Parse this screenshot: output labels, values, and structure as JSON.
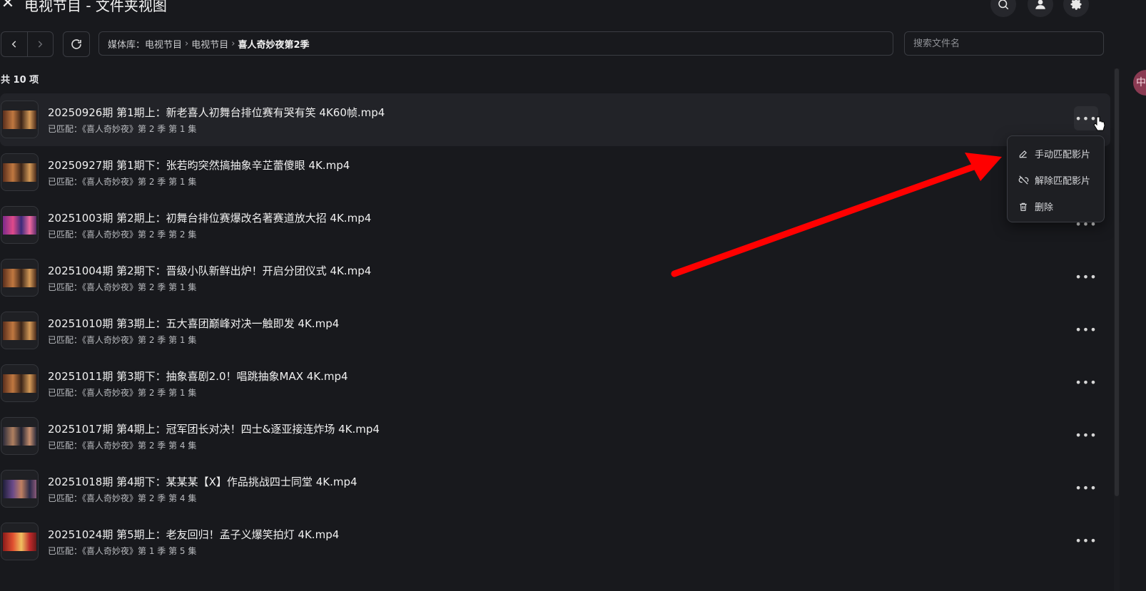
{
  "header": {
    "title": "电视节目 - 文件夹视图"
  },
  "toolbar": {
    "breadcrumb": [
      "媒体库：电视节目",
      "电视节目",
      "喜人奇妙夜第2季"
    ],
    "search_placeholder": "搜索文件名"
  },
  "count_label": "共 10 项",
  "files": [
    {
      "name": "20250926期 第1期上：新老喜人初舞台排位赛有哭有笑 4K60帧.mp4",
      "match": "已匹配：《喜人奇妙夜》第 2 季 第 1 集"
    },
    {
      "name": "20250927期 第1期下：张若昀突然搞抽象辛芷蕾傻眼 4K.mp4",
      "match": "已匹配：《喜人奇妙夜》第 2 季 第 1 集"
    },
    {
      "name": "20251003期 第2期上：初舞台排位赛爆改名著赛道放大招 4K.mp4",
      "match": "已匹配：《喜人奇妙夜》第 2 季 第 2 集"
    },
    {
      "name": "20251004期 第2期下：晋级小队新鲜出炉！开启分团仪式 4K.mp4",
      "match": "已匹配：《喜人奇妙夜》第 2 季 第 1 集"
    },
    {
      "name": "20251010期 第3期上：五大喜团巅峰对决一触即发 4K.mp4",
      "match": "已匹配：《喜人奇妙夜》第 2 季 第 1 集"
    },
    {
      "name": "20251011期 第3期下：抽象喜剧2.0！唱跳抽象MAX 4K.mp4",
      "match": "已匹配：《喜人奇妙夜》第 2 季 第 1 集"
    },
    {
      "name": "20251017期 第4期上：冠军团长对决！四士&逐亚接连炸场 4K.mp4",
      "match": "已匹配：《喜人奇妙夜》第 2 季 第 4 集"
    },
    {
      "name": "20251018期 第4期下：某某某【X】作品挑战四士同堂 4K.mp4",
      "match": "已匹配：《喜人奇妙夜》第 2 季 第 4 集"
    },
    {
      "name": "20251024期 第5期上：老友回归！孟子义爆笑拍灯 4K.mp4",
      "match": "已匹配：《喜人奇妙夜》第 1 季 第 5 集"
    }
  ],
  "context_menu": {
    "items": [
      {
        "label": "手动匹配影片",
        "icon": "pencil-icon"
      },
      {
        "label": "解除匹配影片",
        "icon": "link-off-icon"
      },
      {
        "label": "删除",
        "icon": "trash-icon"
      }
    ]
  },
  "side_avatar_text": "中",
  "colors": {
    "background": "#18191d",
    "arrow": "#ff0000",
    "row_hover": "#222328"
  }
}
